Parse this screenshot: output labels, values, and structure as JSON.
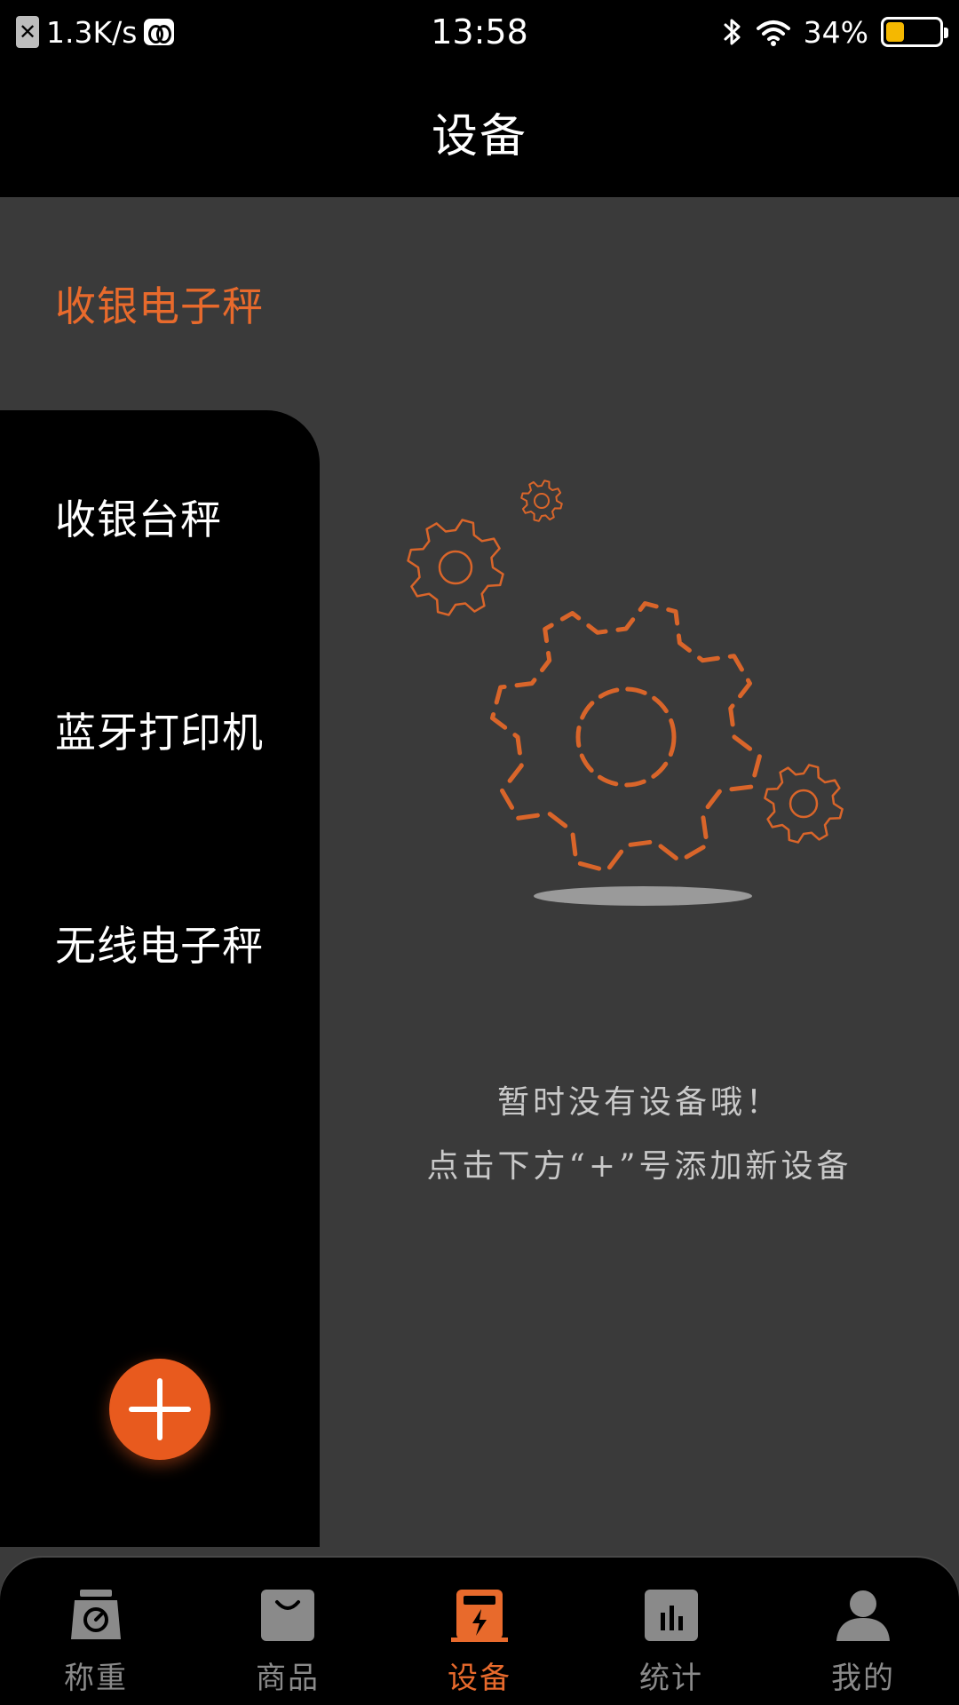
{
  "status_bar": {
    "net_speed": "1.3K/s",
    "time": "13:58",
    "battery": "34%",
    "battery_level": 0.34,
    "icons": [
      "x-icon",
      "app-icon",
      "bluetooth-icon",
      "wifi-icon",
      "battery-icon"
    ]
  },
  "header": {
    "title": "设备"
  },
  "sidebar": {
    "items": [
      {
        "label": "收银电子秤",
        "active": true
      },
      {
        "label": "收银台秤",
        "active": false
      },
      {
        "label": "蓝牙打印机",
        "active": false
      },
      {
        "label": "无线电子秤",
        "active": false
      }
    ],
    "add_icon": "plus-icon"
  },
  "empty_state": {
    "line1": "暂时没有设备哦！",
    "line2": "点击下方“+”号添加新设备",
    "icon": "gears-icon"
  },
  "tabs": [
    {
      "label": "称重",
      "icon": "scale-icon",
      "active": false
    },
    {
      "label": "商品",
      "icon": "bag-icon",
      "active": false
    },
    {
      "label": "设备",
      "icon": "device-icon",
      "active": true
    },
    {
      "label": "统计",
      "icon": "chart-icon",
      "active": false
    },
    {
      "label": "我的",
      "icon": "user-icon",
      "active": false
    }
  ],
  "colors": {
    "accent": "#e86a2c",
    "fab": "#e85a1e",
    "content_bg": "#3a3a3a",
    "bar_bg": "#000000",
    "tab_inactive": "#8a8a8a",
    "battery": "#f5b800"
  }
}
